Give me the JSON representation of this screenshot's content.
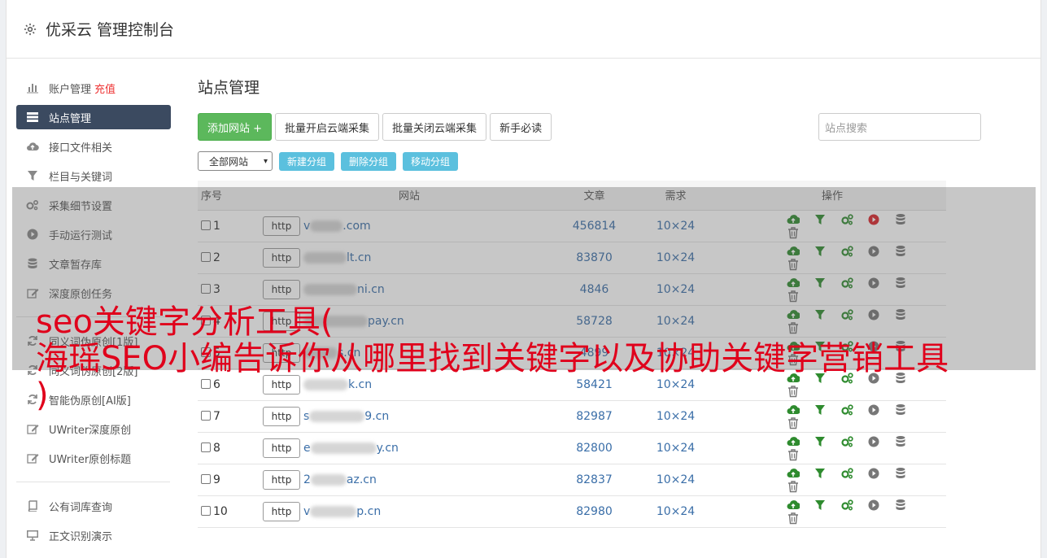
{
  "app": {
    "title": "优采云 管理控制台"
  },
  "sidebar": {
    "items": [
      {
        "label": "账户管理",
        "badge": "充值",
        "icon": "bar-chart-icon"
      },
      {
        "label": "站点管理",
        "icon": "server-icon",
        "active": true
      },
      {
        "label": "接口文件相关",
        "icon": "cloud-upload-icon"
      },
      {
        "label": "栏目与关键词",
        "icon": "filter-icon"
      },
      {
        "label": "采集细节设置",
        "icon": "gears-icon"
      },
      {
        "label": "手动运行测试",
        "icon": "play-circle-icon"
      },
      {
        "label": "文章暂存库",
        "icon": "database-icon"
      },
      {
        "label": "深度原创任务",
        "icon": "edit-icon"
      },
      {
        "label": "同义词伪原创[1版]",
        "icon": "refresh-icon"
      },
      {
        "label": "同义词伪原创[2版]",
        "icon": "refresh-icon"
      },
      {
        "label": "智能伪原创[AI版]",
        "icon": "refresh-icon"
      },
      {
        "label": "UWriter深度原创",
        "icon": "edit-icon"
      },
      {
        "label": "UWriter原创标题",
        "icon": "edit-icon"
      }
    ],
    "items2": [
      {
        "label": "公有词库查询",
        "icon": "book-icon"
      },
      {
        "label": "正文识别演示",
        "icon": "monitor-icon"
      }
    ]
  },
  "main": {
    "title": "站点管理",
    "buttons": {
      "add": "添加网站 +",
      "batch_open": "批量开启云端采集",
      "batch_close": "批量关闭云端采集",
      "guide": "新手必读"
    },
    "search_placeholder": "站点搜索",
    "group_select": "全部网站",
    "group_buttons": {
      "new": "新建分组",
      "delete": "删除分组",
      "move": "移动分组"
    },
    "table": {
      "headers": {
        "no": "序号",
        "site": "网站",
        "articles": "文章",
        "demand": "需求",
        "ops": "操作"
      },
      "http_label": "http",
      "rows": [
        {
          "no": "1",
          "prefix": "v",
          "suffix": ".com",
          "articles": "456814",
          "demand": "10×24",
          "running": true
        },
        {
          "no": "2",
          "prefix": "",
          "suffix": "lt.cn",
          "articles": "83870",
          "demand": "10×24",
          "running": false
        },
        {
          "no": "3",
          "prefix": "",
          "suffix": "ni.cn",
          "articles": "4846",
          "demand": "10×24",
          "running": false
        },
        {
          "no": "4",
          "prefix": "",
          "suffix": "pay.cn",
          "articles": "58728",
          "demand": "10×24",
          "running": false
        },
        {
          "no": "5",
          "prefix": "",
          "suffix": "s.cn",
          "articles": "4899",
          "demand": "10×24",
          "running": false
        },
        {
          "no": "6",
          "prefix": "",
          "suffix": "k.cn",
          "articles": "58421",
          "demand": "10×24",
          "running": false
        },
        {
          "no": "7",
          "prefix": "s",
          "suffix": "9.cn",
          "articles": "82987",
          "demand": "10×24",
          "running": false
        },
        {
          "no": "8",
          "prefix": "e",
          "suffix": "y.cn",
          "articles": "82800",
          "demand": "10×24",
          "running": false
        },
        {
          "no": "9",
          "prefix": "2",
          "suffix": "az.cn",
          "articles": "82837",
          "demand": "10×24",
          "running": false
        },
        {
          "no": "10",
          "prefix": "v",
          "suffix": "p.cn",
          "articles": "82980",
          "demand": "10×24",
          "running": false
        }
      ]
    }
  },
  "overlay": {
    "line1": "seo关键字分析工具(",
    "line2": "海瑶SEO小编告诉你从哪里找到关键字以及协助关键字营销工具",
    "line3": ")"
  },
  "colors": {
    "accent_green": "#5cb85c",
    "info_blue": "#5bc0de",
    "sidebar_active": "#3b4a60",
    "headline_red": "#e0001b",
    "link_blue": "#3a6ea8"
  }
}
